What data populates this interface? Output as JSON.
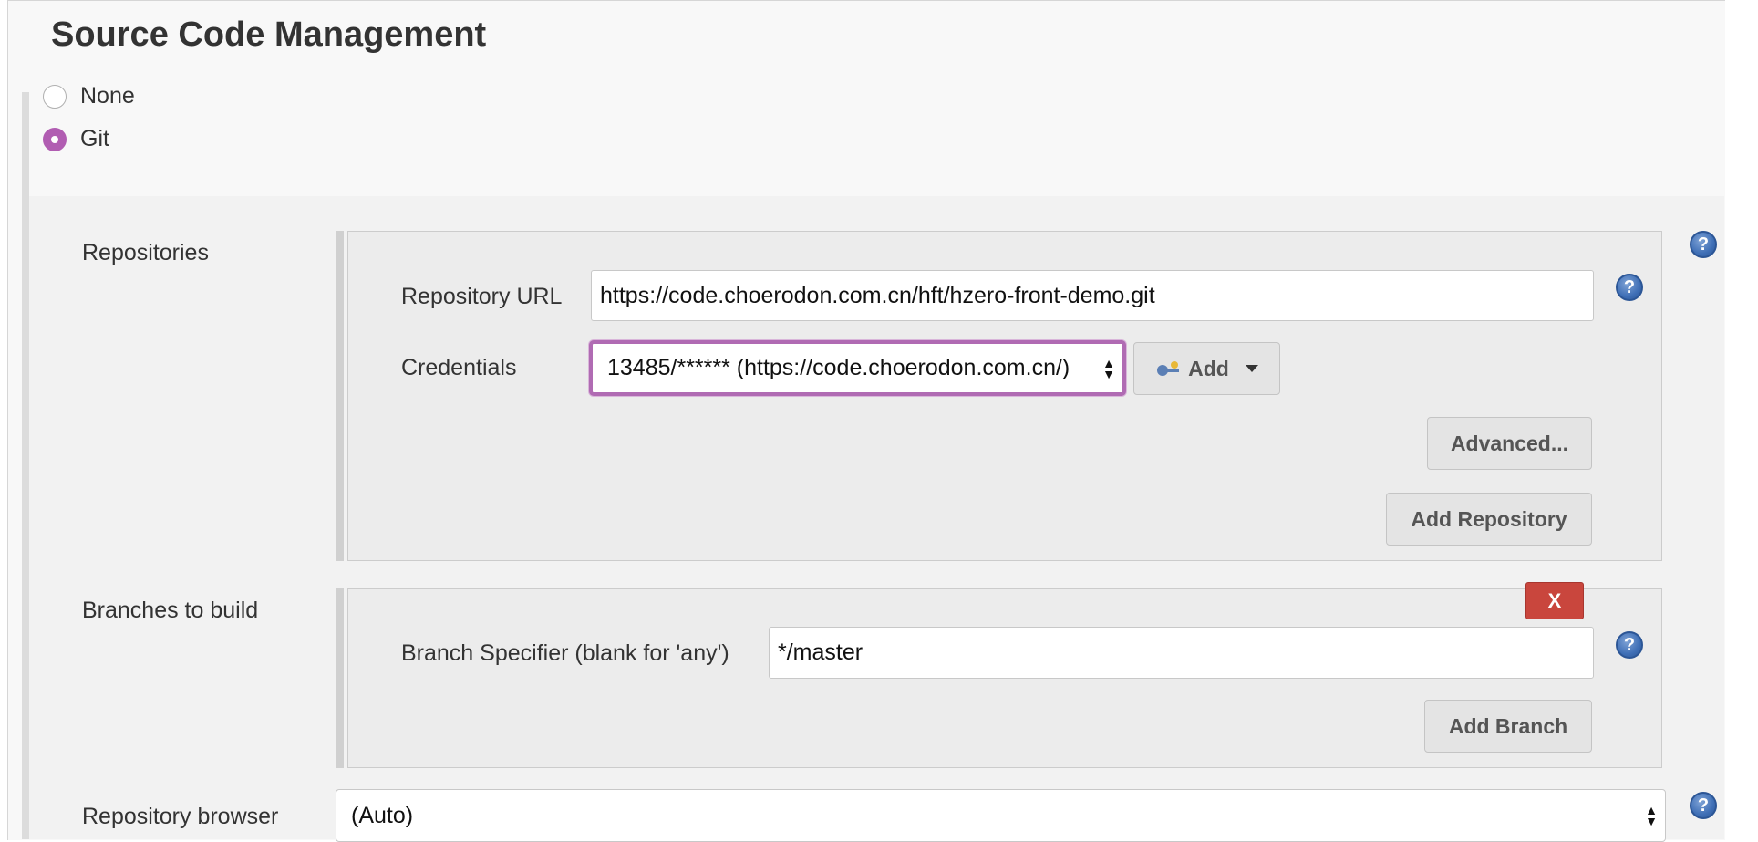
{
  "section": {
    "title": "Source Code Management"
  },
  "scm_options": [
    {
      "label": "None",
      "selected": false
    },
    {
      "label": "Git",
      "selected": true
    }
  ],
  "repositories": {
    "label": "Repositories",
    "url_label": "Repository URL",
    "url_value": "https://code.choerodon.com.cn/hft/hzero-front-demo.git",
    "credentials_label": "Credentials",
    "credentials_value": "13485/****** (https://code.choerodon.com.cn/)",
    "add_button": "Add",
    "advanced_button": "Advanced...",
    "add_repository_button": "Add Repository"
  },
  "branches": {
    "label": "Branches to build",
    "specifier_label": "Branch Specifier (blank for 'any')",
    "specifier_value": "*/master",
    "delete_button": "X",
    "add_branch_button": "Add Branch"
  },
  "repository_browser": {
    "label": "Repository browser",
    "value": "(Auto)"
  },
  "help_icon_glyph": "?",
  "colors": {
    "accent": "#b15db2",
    "delete": "#c9463d",
    "help": "#3f6fb6"
  }
}
